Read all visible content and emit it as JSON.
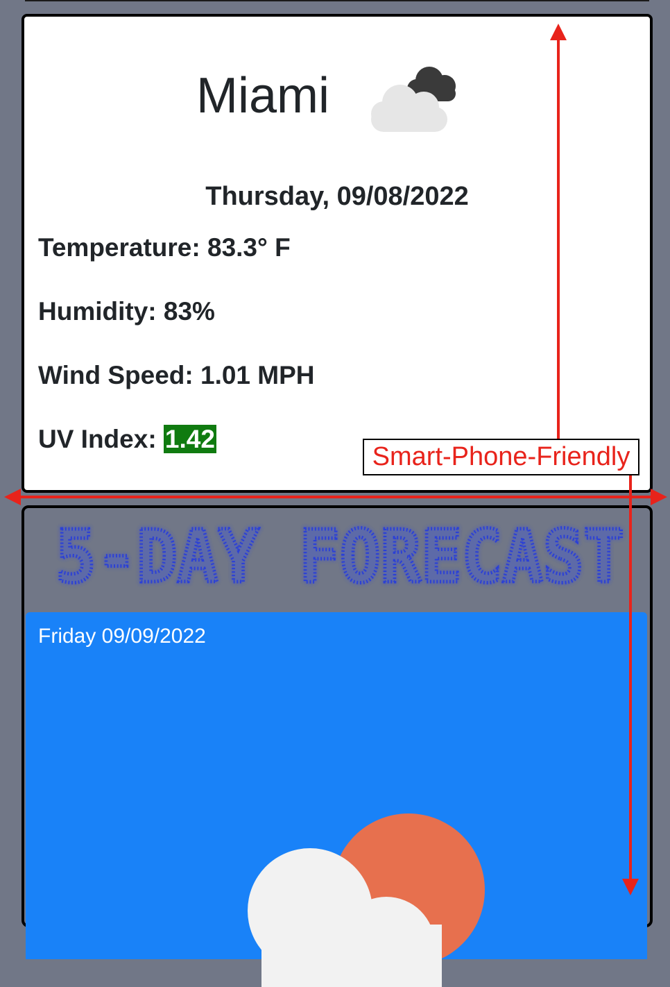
{
  "current": {
    "city": "Miami",
    "icon": "cloudy-icon",
    "date": "Thursday, 09/08/2022",
    "temperature": "Temperature: 83.3° F",
    "humidity": "Humidity: 83%",
    "wind_speed": "Wind Speed: 1.01 MPH",
    "uv_label": "UV Index: ",
    "uv_value": "1.42",
    "uv_color": "#107b10"
  },
  "forecast": {
    "title": "5-DAY FORECAST",
    "title_color": "#2c3fd6",
    "days": [
      {
        "date": "Friday 09/09/2022",
        "icon": "partly-cloudy-sun-icon",
        "background": "#1982f8"
      }
    ]
  },
  "annotation": {
    "label": "Smart-Phone-Friendly",
    "color": "#e8231b"
  },
  "colors": {
    "page_background": "#717787",
    "card_background": "#ffffff"
  }
}
